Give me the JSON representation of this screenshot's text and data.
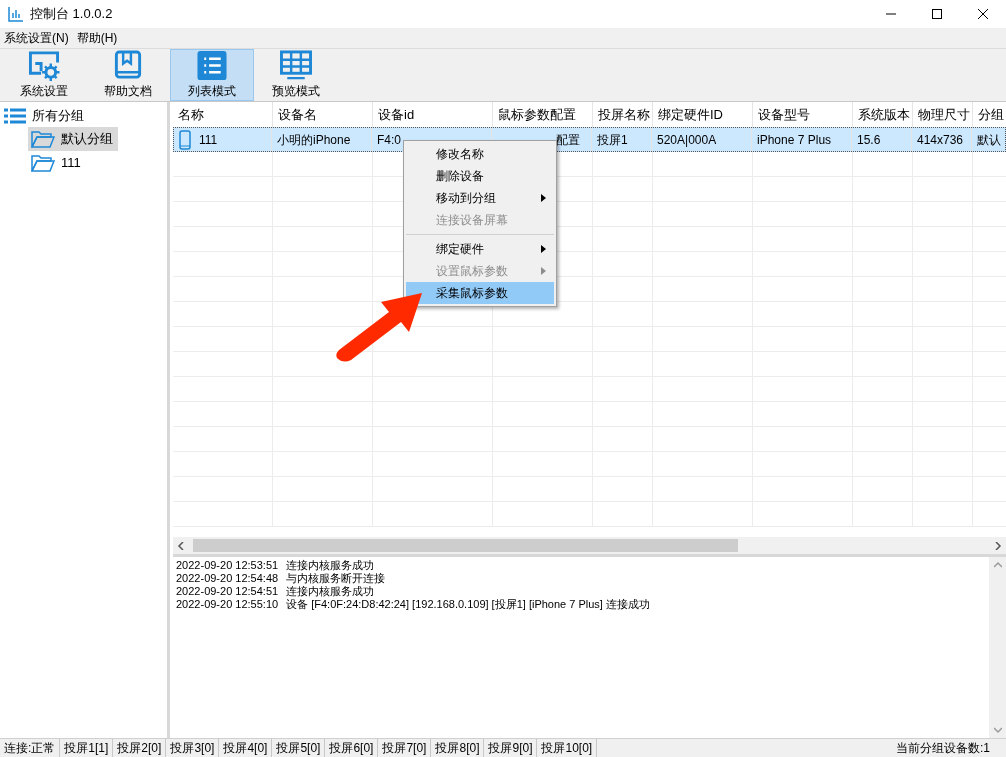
{
  "window": {
    "title": "控制台 1.0.0.2"
  },
  "menu_bar": [
    "系统设置(N)",
    "帮助(H)"
  ],
  "toolbar": [
    {
      "label": "系统设置",
      "kind": "settings",
      "selected": false
    },
    {
      "label": "帮助文档",
      "kind": "book",
      "selected": false
    },
    {
      "label": "列表模式",
      "kind": "list",
      "selected": true
    },
    {
      "label": "预览模式",
      "kind": "grid",
      "selected": false
    }
  ],
  "sidebar": {
    "root": "所有分组",
    "children": [
      {
        "label": "默认分组",
        "selected": true
      },
      {
        "label": "111",
        "selected": false
      }
    ]
  },
  "table": {
    "columns": [
      "名称",
      "设备名",
      "设备id",
      "鼠标参数配置",
      "投屏名称",
      "绑定硬件ID",
      "设备型号",
      "系统版本",
      "物理尺寸",
      "分组"
    ],
    "rows": [
      {
        "selected": true,
        "cells": [
          "111",
          "小明的iPhone",
          "F4:0",
          "配置",
          "投屏1",
          "520A|000A",
          "iPhone 7 Plus",
          "15.6",
          "414x736",
          "默认"
        ]
      }
    ]
  },
  "context_menu": [
    {
      "label": "修改名称",
      "disabled": false,
      "submenu": false,
      "selected": false,
      "separator_after": false
    },
    {
      "label": "删除设备",
      "disabled": false,
      "submenu": false,
      "selected": false,
      "separator_after": false
    },
    {
      "label": "移动到分组",
      "disabled": false,
      "submenu": true,
      "selected": false,
      "separator_after": false
    },
    {
      "label": "连接设备屏幕",
      "disabled": true,
      "submenu": false,
      "selected": false,
      "separator_after": true
    },
    {
      "label": "绑定硬件",
      "disabled": false,
      "submenu": true,
      "selected": false,
      "separator_after": false
    },
    {
      "label": "设置鼠标参数",
      "disabled": true,
      "submenu": true,
      "selected": false,
      "separator_after": false
    },
    {
      "label": "采集鼠标参数",
      "disabled": false,
      "submenu": false,
      "selected": true,
      "separator_after": false
    }
  ],
  "log": [
    {
      "time": "2022-09-20 12:53:51",
      "message": "连接内核服务成功"
    },
    {
      "time": "2022-09-20 12:54:48",
      "message": "与内核服务断开连接"
    },
    {
      "time": "2022-09-20 12:54:51",
      "message": "连接内核服务成功"
    },
    {
      "time": "2022-09-20 12:55:10",
      "message": "设备 [F4:0F:24:D8:42:24]  [192.168.0.109]  [投屏1]  [iPhone 7 Plus]  连接成功"
    }
  ],
  "status_bar": {
    "items": [
      "连接:正常",
      "投屏1[1]",
      "投屏2[0]",
      "投屏3[0]",
      "投屏4[0]",
      "投屏5[0]",
      "投屏6[0]",
      "投屏7[0]",
      "投屏8[0]",
      "投屏9[0]",
      "投屏10[0]"
    ],
    "right": "当前分组设备数:1"
  }
}
